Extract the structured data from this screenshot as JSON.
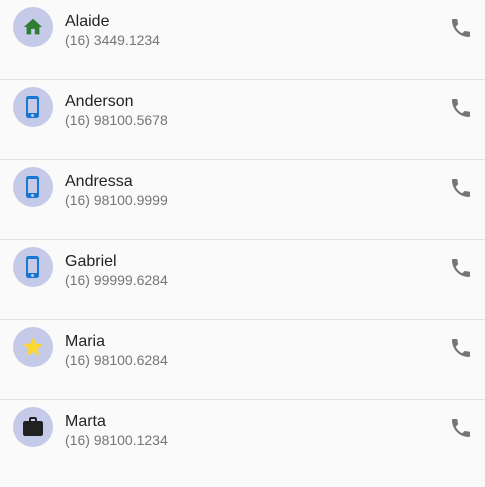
{
  "contacts": [
    {
      "name": "Alaide",
      "phone": "(16) 3449.1234",
      "type_icon": "home-icon",
      "icon_color": "#2e7d32"
    },
    {
      "name": "Anderson",
      "phone": "(16) 98100.5678",
      "type_icon": "smartphone-icon",
      "icon_color": "#1976d2"
    },
    {
      "name": "Andressa",
      "phone": "(16) 98100.9999",
      "type_icon": "smartphone-icon",
      "icon_color": "#1976d2"
    },
    {
      "name": "Gabriel",
      "phone": "(16) 99999.6284",
      "type_icon": "smartphone-icon",
      "icon_color": "#1976d2"
    },
    {
      "name": "Maria",
      "phone": "(16) 98100.6284",
      "type_icon": "star-icon",
      "icon_color": "#fdd835"
    },
    {
      "name": "Marta",
      "phone": "(16) 98100.1234",
      "type_icon": "briefcase-icon",
      "icon_color": "#212121"
    }
  ],
  "call_icon": "phone-icon",
  "colors": {
    "avatar_background": "#c5cae9",
    "call_icon": "#757575",
    "background": "#fafafa",
    "divider": "#e2e2e2"
  }
}
